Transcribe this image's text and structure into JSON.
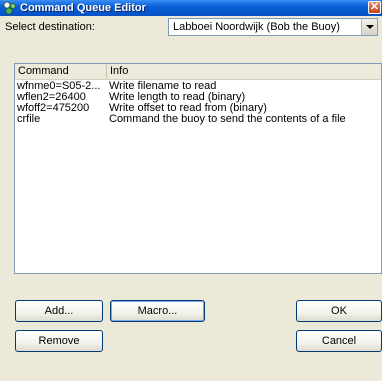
{
  "window": {
    "title": "Command Queue Editor",
    "close_glyph": "✕"
  },
  "destination": {
    "label": "Select destination:",
    "selected": "Labboei Noordwijk (Bob the Buoy)"
  },
  "list": {
    "columns": [
      "Command",
      "Info"
    ],
    "rows": [
      {
        "command": "wfnme0=S05-2...",
        "info": "Write filename to read"
      },
      {
        "command": "wflen2=26400",
        "info": "Write length to read (binary)"
      },
      {
        "command": "wfoff2=475200",
        "info": "Write offset to read from (binary)"
      },
      {
        "command": "crfile",
        "info": "Command the buoy to send the contents of a file"
      }
    ]
  },
  "buttons": {
    "add": "Add...",
    "macro": "Macro...",
    "ok": "OK",
    "remove": "Remove",
    "cancel": "Cancel"
  },
  "colors": {
    "title_bar": "#0550c4",
    "dialog_bg": "#ece9d8",
    "list_border": "#7f9db9"
  },
  "icons": {
    "title": "satellite-icon",
    "dropdown": "chevron-down-icon",
    "close": "close-icon"
  }
}
